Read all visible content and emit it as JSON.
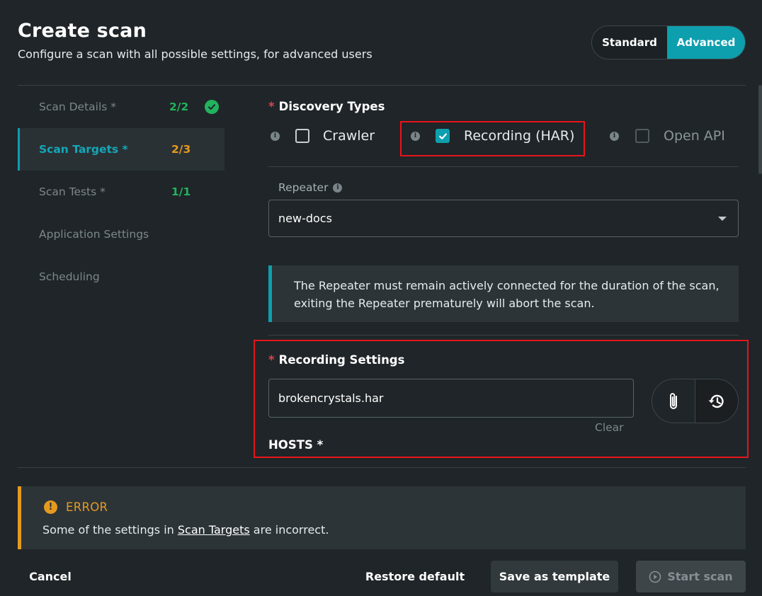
{
  "header": {
    "title": "Create scan",
    "subtitle": "Configure a scan with all possible settings, for advanced users"
  },
  "mode_toggle": {
    "standard": "Standard",
    "advanced": "Advanced",
    "selected": "Advanced"
  },
  "nav": {
    "items": [
      {
        "label": "Scan Details *",
        "count": "2/2",
        "status": "complete"
      },
      {
        "label": "Scan Targets *",
        "count": "2/3",
        "status": "incomplete",
        "active": true
      },
      {
        "label": "Scan Tests *",
        "count": "1/1",
        "status": "complete"
      },
      {
        "label": "Application Settings",
        "count": ""
      },
      {
        "label": "Scheduling",
        "count": ""
      }
    ]
  },
  "discovery": {
    "title": "Discovery Types",
    "options": [
      {
        "label": "Crawler",
        "checked": false,
        "disabled": false
      },
      {
        "label": "Recording (HAR)",
        "checked": true,
        "disabled": false
      },
      {
        "label": "Open API",
        "checked": false,
        "disabled": true
      }
    ]
  },
  "repeater": {
    "label": "Repeater",
    "value": "new-docs",
    "notice_line1": "The Repeater must remain actively connected for the duration of the scan,",
    "notice_line2": "exiting the Repeater prematurely will abort the scan."
  },
  "recording": {
    "title": "Recording Settings",
    "file_value": "brokencrystals.har",
    "clear_label": "Clear",
    "hosts_label": "HOSTS *"
  },
  "error": {
    "title": "ERROR",
    "message_prefix": "Some of the settings in ",
    "message_link": "Scan Targets",
    "message_suffix": " are incorrect."
  },
  "footer": {
    "cancel": "Cancel",
    "restore": "Restore default",
    "save_template": "Save as template",
    "start_scan": "Start scan"
  },
  "colors": {
    "accent": "#0e9fae",
    "success": "#22b35e",
    "warning": "#e59a1f",
    "highlight": "#e8141c"
  }
}
